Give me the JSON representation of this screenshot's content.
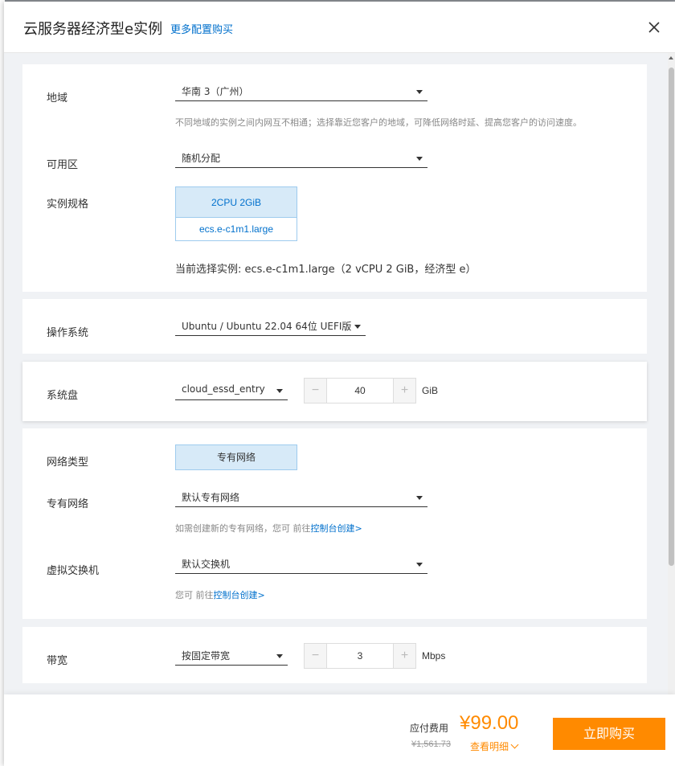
{
  "header": {
    "title": "云服务器经济型e实例",
    "more_config_link": "更多配置购买"
  },
  "region": {
    "label": "地域",
    "value": "华南 3（广州）",
    "hint": "不同地域的实例之间内网互不相通；选择靠近您客户的地域，可降低网络时延、提高您客户的访问速度。"
  },
  "zone": {
    "label": "可用区",
    "value": "随机分配"
  },
  "spec": {
    "label": "实例规格",
    "card_top": "2CPU 2GiB",
    "card_bottom": "ecs.e-c1m1.large",
    "current": "当前选择实例: ecs.e-c1m1.large（2 vCPU 2 GiB，经济型 e）"
  },
  "os": {
    "label": "操作系统",
    "value": "Ubuntu / Ubuntu 22.04 64位 UEFI版"
  },
  "disk": {
    "label": "系统盘",
    "type": "cloud_essd_entry",
    "size": "40",
    "unit": "GiB",
    "minus": "−",
    "plus": "+"
  },
  "network": {
    "type_label": "网络类型",
    "type_value": "专有网络",
    "vpc_label": "专有网络",
    "vpc_value": "默认专有网络",
    "vpc_hint": "如需创建新的专有网络，您可 前往",
    "vpc_hint_link": "控制台创建>",
    "vswitch_label": "虚拟交换机",
    "vswitch_value": "默认交换机",
    "vswitch_hint": "您可 前往",
    "vswitch_hint_link": "控制台创建>"
  },
  "bandwidth": {
    "label": "带宽",
    "type": "按固定带宽",
    "value": "3",
    "unit": "Mbps",
    "minus": "−",
    "plus": "+"
  },
  "footer": {
    "fee_label": "应付费用",
    "price": "¥99.00",
    "original_price": "¥1,561.73",
    "detail_link": "查看明细",
    "buy_button": "立即购买"
  },
  "colors": {
    "accent": "#ff8a00",
    "link": "#0070cc",
    "selected_bg": "#d7eaf8"
  }
}
